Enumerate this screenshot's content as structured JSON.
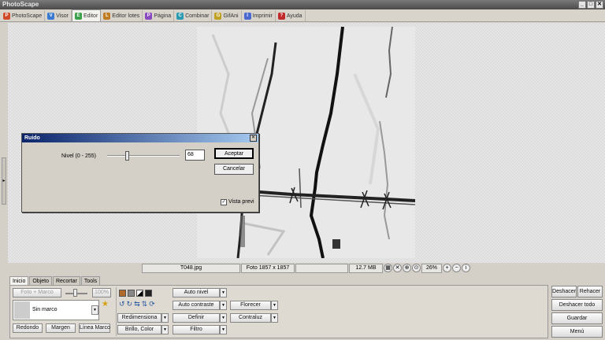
{
  "app": {
    "title": "PhotoScape",
    "min_label": "_",
    "max_label": "□",
    "close_label": "✕"
  },
  "tabs": [
    {
      "label": "PhotoScape",
      "icon": "P",
      "color": "#d04a2a"
    },
    {
      "label": "Visor",
      "icon": "V",
      "color": "#3a7ad0"
    },
    {
      "label": "Editor",
      "icon": "E",
      "color": "#3aa04a"
    },
    {
      "label": "Editor lotes",
      "icon": "L",
      "color": "#c07a20"
    },
    {
      "label": "Página",
      "icon": "P",
      "color": "#8a4ac0"
    },
    {
      "label": "Combinar",
      "icon": "C",
      "color": "#2a9ab0"
    },
    {
      "label": "GifAni",
      "icon": "G",
      "color": "#c0a020"
    },
    {
      "label": "Imprimir",
      "icon": "I",
      "color": "#4a6ad0"
    },
    {
      "label": "Ayuda",
      "icon": "?",
      "color": "#c02a2a"
    }
  ],
  "status": {
    "filename": "T048.jpg",
    "dimensions": "Foto 1857 x 1857",
    "filesize": "12.7 MB",
    "zoom": "26%"
  },
  "bottom": {
    "tabs": [
      "Inicio",
      "Objeto",
      "Recortar",
      "Tools"
    ],
    "foto_marco": "Foto + Marco",
    "percent": "100%",
    "frame": "Sin marco",
    "redondo": "Redondo",
    "margen": "Margen",
    "linea_marco": "Línea Marco",
    "redimensiona": "Redimensiona",
    "brillo": "Brillo, Color",
    "auto_nivel": "Auto nivel",
    "auto_contraste": "Auto contraste",
    "definir": "Definir",
    "filtro": "Filtro",
    "florecer": "Florecer",
    "contraluz": "Contraluz",
    "deshacer": "Deshacer",
    "rehacer": "Rehacer",
    "deshacer_todo": "Deshacer todo",
    "guardar": "Guardar",
    "menu": "Menú"
  },
  "dialog": {
    "title": "Ruido",
    "label": "Nivel (0 - 255)",
    "value": "68",
    "level": 68,
    "max": 255,
    "accept": "Aceptar",
    "cancel": "Cancelar",
    "preview": "Vista previ",
    "preview_checked": true
  },
  "colors": {
    "accent": "#0a246a"
  }
}
